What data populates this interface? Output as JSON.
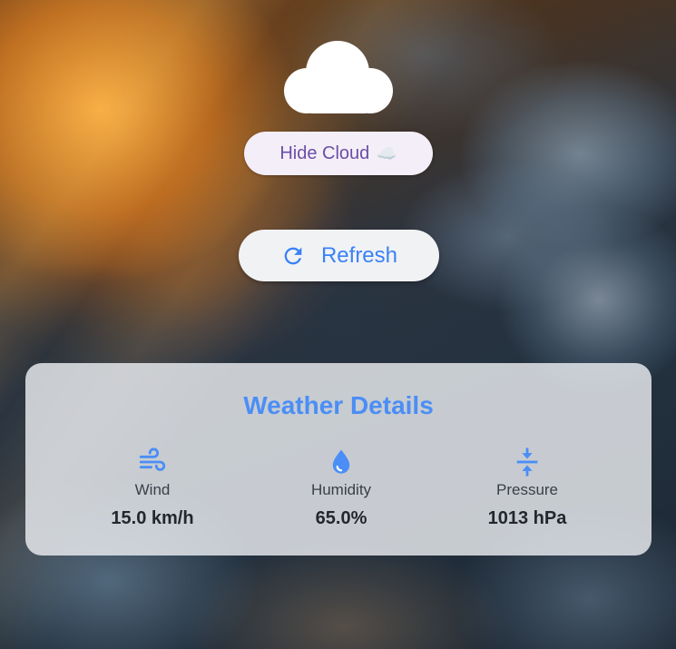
{
  "weather_icon": "cloud-icon",
  "controls": {
    "hide_cloud_label": "Hide Cloud",
    "hide_cloud_emoji": "☁️",
    "refresh_label": "Refresh",
    "refresh_icon": "refresh-icon"
  },
  "details": {
    "title": "Weather Details",
    "metrics": [
      {
        "icon": "wind-icon",
        "label": "Wind",
        "value": "15.0 km/h"
      },
      {
        "icon": "humidity-drop-icon",
        "label": "Humidity",
        "value": "65.0%"
      },
      {
        "icon": "pressure-icon",
        "label": "Pressure",
        "value": "1013 hPa"
      }
    ]
  },
  "colors": {
    "accent_blue": "#3b82f6",
    "title_blue": "#4b8ef5",
    "hide_cloud_text": "#6a4fa6",
    "hide_cloud_bg": "#f4eef8",
    "card_bg": "#eceef1"
  }
}
